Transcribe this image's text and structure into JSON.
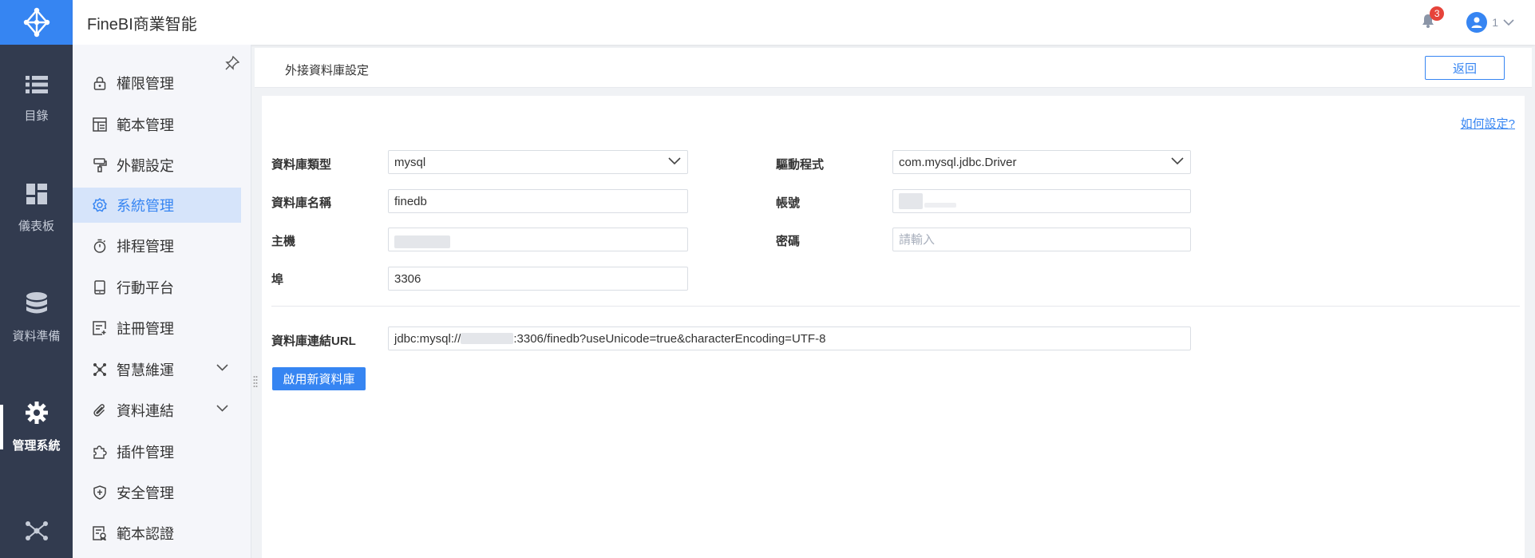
{
  "app": {
    "title": "FineBI商業智能"
  },
  "rail": {
    "items": [
      {
        "label": "目錄",
        "icon": "list-icon"
      },
      {
        "label": "儀表板",
        "icon": "dashboard-icon"
      },
      {
        "label": "資料準備",
        "icon": "database-icon"
      },
      {
        "label": "管理系統",
        "icon": "gear-icon",
        "active": true
      },
      {
        "label": "",
        "icon": "network-icon"
      }
    ]
  },
  "header": {
    "notification_count": "3",
    "user_name": "1"
  },
  "sidebar": {
    "items": [
      {
        "label": "權限管理",
        "icon": "lock-icon"
      },
      {
        "label": "範本管理",
        "icon": "template-icon"
      },
      {
        "label": "外觀設定",
        "icon": "brush-icon"
      },
      {
        "label": "系統管理",
        "icon": "gear-icon",
        "active": true
      },
      {
        "label": "排程管理",
        "icon": "timer-icon"
      },
      {
        "label": "行動平台",
        "icon": "mobile-icon"
      },
      {
        "label": "註冊管理",
        "icon": "register-icon"
      },
      {
        "label": "智慧維運",
        "icon": "ops-icon",
        "expandable": true
      },
      {
        "label": "資料連結",
        "icon": "paperclip-icon",
        "expandable": true
      },
      {
        "label": "插件管理",
        "icon": "puzzle-icon"
      },
      {
        "label": "安全管理",
        "icon": "shield-icon"
      },
      {
        "label": "範本認證",
        "icon": "certify-icon"
      }
    ]
  },
  "main": {
    "title": "外接資料庫設定",
    "back_label": "返回",
    "howto_label": "如何設定?",
    "form": {
      "db_type_label": "資料庫類型",
      "db_type_value": "mysql",
      "driver_label": "驅動程式",
      "driver_value": "com.mysql.jdbc.Driver",
      "db_name_label": "資料庫名稱",
      "db_name_value": "finedb",
      "account_label": "帳號",
      "host_label": "主機",
      "password_label": "密碼",
      "password_placeholder": "請輸入",
      "port_label": "埠",
      "port_value": "3306",
      "url_label": "資料庫連結URL",
      "url_prefix": "jdbc:mysql://",
      "url_suffix": ":3306/finedb?useUnicode=true&characterEncoding=UTF-8"
    },
    "enable_button_label": "啟用新資料庫"
  },
  "colors": {
    "accent": "#3685f2",
    "rail_bg": "#323b4f",
    "badge": "#e6433a"
  }
}
